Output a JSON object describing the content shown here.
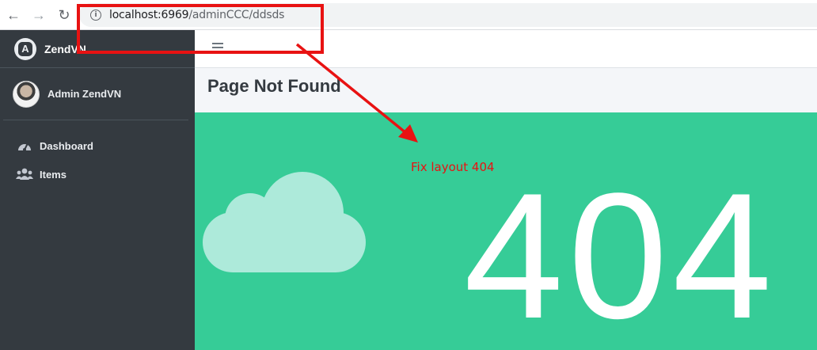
{
  "browser": {
    "url_host": "localhost:6969",
    "url_path": "/adminCCC/ddsds"
  },
  "sidebar": {
    "brand": "ZendVN",
    "user_name": "Admin ZendVN",
    "items": [
      {
        "label": "Dashboard",
        "icon": "tachometer-icon"
      },
      {
        "label": "Items",
        "icon": "users-icon"
      }
    ]
  },
  "content": {
    "page_title": "Page Not Found",
    "error_code": "404"
  },
  "annotation": {
    "note": "Fix layout 404"
  },
  "colors": {
    "sidebar": "#343a40",
    "error_panel": "#36cc97",
    "cloud": "#adeada",
    "annotation": "#e81212"
  }
}
